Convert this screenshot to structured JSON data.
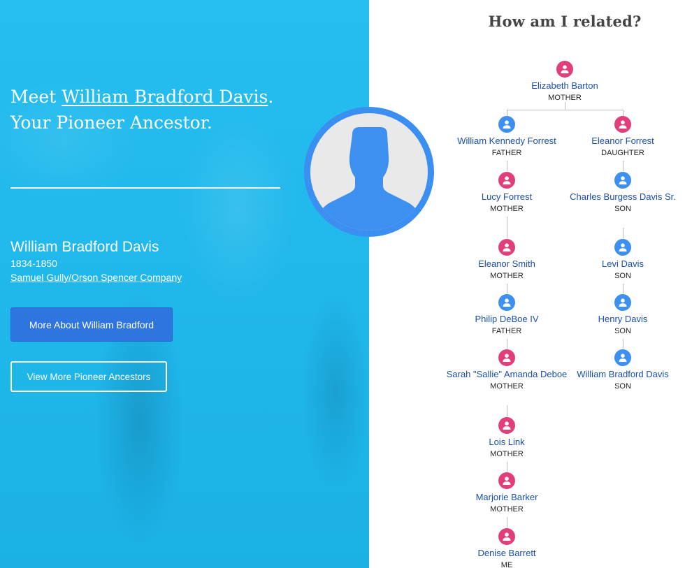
{
  "hero": {
    "heading_meet": "Meet ",
    "heading_name": "William Bradford Davis",
    "heading_period": ".",
    "heading_line2": "Your Pioneer Ancestor.",
    "name": "William Bradford Davis",
    "years": "1834-1850",
    "company": "Samuel Gully/Orson Spencer Company",
    "btn_more": "More About William Bradford",
    "btn_view": "View More Pioneer Ancestors",
    "bg_color": "#1dbbef"
  },
  "avatar": {
    "icon": "person-silhouette-icon"
  },
  "tree": {
    "title": "How am I related?",
    "root": {
      "name": "Elizabeth Barton",
      "rel": "MOTHER",
      "gender": "f"
    },
    "left": [
      {
        "name": "William Kennedy Forrest",
        "rel": "FATHER",
        "gender": "m"
      },
      {
        "name": "Lucy Forrest",
        "rel": "MOTHER",
        "gender": "f"
      },
      {
        "name": "Eleanor Smith",
        "rel": "MOTHER",
        "gender": "f"
      },
      {
        "name": "Philip DeBoe IV",
        "rel": "FATHER",
        "gender": "m"
      },
      {
        "name": "Sarah \"Sallie\" Amanda Deboe",
        "rel": "MOTHER",
        "gender": "f"
      },
      {
        "name": "Lois Link",
        "rel": "MOTHER",
        "gender": "f"
      },
      {
        "name": "Marjorie Barker",
        "rel": "MOTHER",
        "gender": "f"
      },
      {
        "name": "Denise Barrett",
        "rel": "ME",
        "gender": "f"
      }
    ],
    "right": [
      {
        "name": "Eleanor Forrest",
        "rel": "DAUGHTER",
        "gender": "f"
      },
      {
        "name": "Charles Burgess Davis Sr.",
        "rel": "SON",
        "gender": "m"
      },
      {
        "name": "Levi Davis",
        "rel": "SON",
        "gender": "m"
      },
      {
        "name": "Henry Davis",
        "rel": "SON",
        "gender": "m"
      },
      {
        "name": "William Bradford Davis",
        "rel": "SON",
        "gender": "m"
      }
    ],
    "colors": {
      "female": "#e03f7c",
      "male": "#3d8ff0",
      "link": "#1a4fb0"
    }
  }
}
